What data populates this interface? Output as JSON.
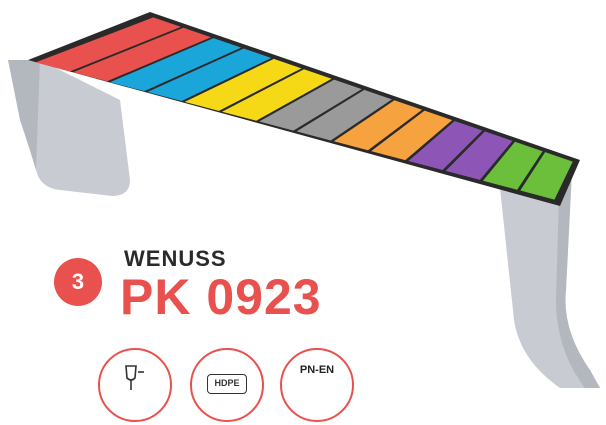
{
  "product": {
    "number": "3",
    "brand": "WENUSS",
    "model": "PK 0923"
  },
  "seat_colors": [
    "#e8514e",
    "#1aa6d9",
    "#f5d816",
    "#9a9a9a",
    "#f6a23e",
    "#8d55b6",
    "#6bbf3b"
  ],
  "certifications": {
    "icon1": "glass-and-fork-icon",
    "icon2": "HDPE",
    "icon3": "PN-EN"
  }
}
